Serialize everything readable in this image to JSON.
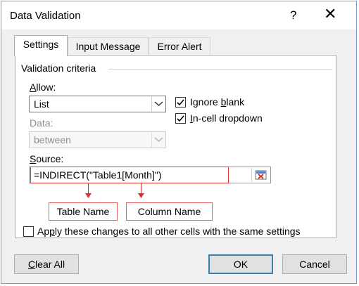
{
  "window": {
    "title": "Data Validation",
    "help": "?",
    "close": "✕"
  },
  "tabs": [
    {
      "label": "Settings"
    },
    {
      "label": "Input Message"
    },
    {
      "label": "Error Alert"
    }
  ],
  "criteria": {
    "group_title": "Validation criteria",
    "allow_label_pre": "",
    "allow_label_u": "A",
    "allow_label_post": "llow:",
    "allow_value": "List",
    "data_label": "Data:",
    "data_value": "between",
    "ignore_blank_pre": "Ignore ",
    "ignore_blank_u": "b",
    "ignore_blank_post": "lank",
    "incell_u": "I",
    "incell_post": "n-cell dropdown",
    "source_u": "S",
    "source_post": "ource:",
    "source_value": "=INDIRECT(\"Table1[Month]\")",
    "ignore_blank_checked": true,
    "incell_checked": true
  },
  "callouts": {
    "table_name": "Table Name",
    "column_name": "Column Name"
  },
  "apply_all": {
    "pre": "Ap",
    "u": "p",
    "post": "ly these changes to all other cells with the same settings",
    "checked": false
  },
  "buttons": {
    "clear_u": "C",
    "clear_post": "lear All",
    "ok": "OK",
    "cancel": "Cancel"
  },
  "colors": {
    "accent": "#3c7fb1",
    "callout": "#e03030"
  }
}
